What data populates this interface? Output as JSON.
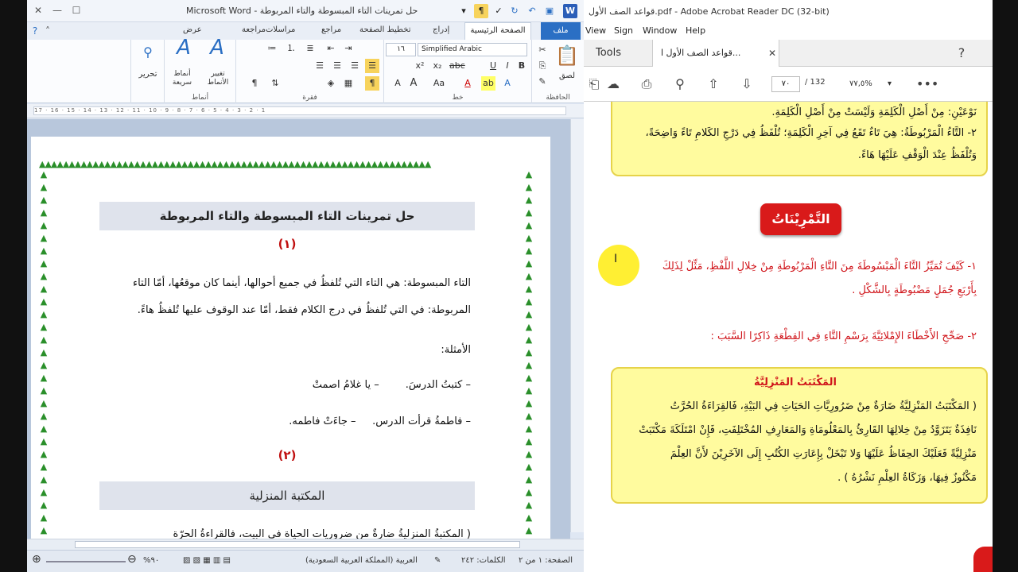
{
  "word": {
    "title": "حل تمرينات التاء المبسوطة والتاء المربوطة  -  Microsoft Word",
    "tabs": [
      "ملف",
      "الصفحة الرئيسية",
      "إدراج",
      "تخطيط الصفحة",
      "مراجع",
      "مراسلات",
      "مراجعة",
      "عرض"
    ],
    "ribbon": {
      "paste": "لصق",
      "clipboard": "الحافظة",
      "font_group": "خط",
      "paragraph_group": "فقرة",
      "styles_group": "أنماط",
      "font_name": "Simplified Arabic",
      "font_size": "١٦",
      "quick_styles": "أنماط سريعة",
      "change_styles": "تغيير الأنماط",
      "editing": "تحرير"
    },
    "ruler": "17 · 16 · 15 · 14 · 13 · 12 · 11 · 10 · 9 · 8 · 7 · 6 · 5 · 4 · 3 · 2 · 1",
    "doc": {
      "heading1": "حل تمرينات التاء المبسوطة والتاء المربوطة",
      "num1": "(١)",
      "p1": "التاء المبسوطة: هي التاء التي تُلفظُ في جميع أحوالها، أينما كان موقعُها، أمّا التاء المربوطة: في التي تُلفظُ في درج الكلام فقط، أمّا عند الوقوف عليها تُلفظُ هاءً.",
      "examples_label": "الأمثلة:",
      "ex1": "– كتبتُ الدرسَ.        – يا غلامُ اصمتْ",
      "ex2": "– فاطمةُ قرأت الدرس.     – جاءَتْ فاطمه.",
      "num2": "(٢)",
      "heading2": "المكتبة المنزلية",
      "p2_start": "( المكتبةُ المنزليةُ ضارةٌ من ضروريات الحياة في البيت، فالقراءةُ الحرّة"
    },
    "status": {
      "page": "الصفحة: ١ من ٢",
      "words": "الكلمات: ٢٤٢",
      "language": "العربية (المملكة العربية السعودية)",
      "zoom": "٩٠%"
    }
  },
  "acrobat": {
    "title": "قواعد الصف الأول.pdf - Adobe Acrobat Reader DC (32-bit)",
    "menu": [
      "View",
      "Sign",
      "Window",
      "Help"
    ],
    "tools_tab": "Tools",
    "doc_tab": "قواعد الصف الأول ا...",
    "page_current": "٧٠",
    "page_total": "/ 132",
    "zoom": "٧٧,٥%",
    "content": {
      "top_line1": "نَوْعَيْنِ: مِنْ أَصْلِ الْكَلِمَةِ وَلَيْسَتْ مِنْ أَصْلِ الْكَلِمَةِ.",
      "top_line2": "٢- التَّاءُ الْمَرْبُوطَةُ: هِيَ تَاءٌ تَقَعُ فِي آخِرِ الْكَلِمَةِ؛ تُلْفَظُ فِي دَرْجِ الكَلامِ تَاءً وَاضِحَةً،",
      "top_line3": "وَتُلْفَظُ عِنْدَ الْوَقْفِ عَلَيْهَا هَاءً.",
      "exercises_title": "التَّمْرِيْنَاتُ",
      "q1_line1": "١- كَيْفَ تُمَيِّزُ التَّاءَ الْمَبْسُوطَةَ مِنَ التَّاءِ الْمَرْبُوطَةِ مِنْ خِلالِ اللَّفْظِ، مَثِّلْ لِذَلِكَ",
      "q1_line2": "بِأَرْبَعِ جُمَلٍ مَضْبُوطَةٍ بِالشَّكْلِ .",
      "q2": "٢- صَحِّحِ الأَخْطَاءَ الإِمْلائِيَّةَ بِرَسْمِ التَّاءِ فِي القِطْعَةِ ذَاكِرًا السَّبَبَ :",
      "passage_title": "المَكْتَبَتُ المَنْزِلِيَّةُ",
      "passage1": "( المَكْتَبَتُ المَنْزِلِيَّةُ ضَارَةٌ مِنْ ضَرُورِيَّاتِ الحَيَاتِ فِي البَيْةِ، فَالقِرَاءَةُ الحُرَّتُ",
      "passage2": "نَافِذَةٌ يَتَزَوَّدُ مِنْ خِلالِهَا القَارِئُ بِالمَعْلُومَاةِ وَالمَعَارِفِ المُخْتَلِفَتِ، فَإِنْ امْتَلَكَةَ مَكْتَبَتْ",
      "passage3": "مَنْزِلِيَّةً فَعَلَيْكَ الحِفَاظُ عَلَيْهَا وَلا تَبْخَلْ بِإِعَارَتِ الكُتُبِ إِلَى الآخَرِيْنَ لأَنَّ العِلْمَ",
      "passage4": "مَكْنُوزٌ فِيهَا، وَزَكَاةُ العِلْمِ نَشْرُهُ ) ."
    }
  }
}
